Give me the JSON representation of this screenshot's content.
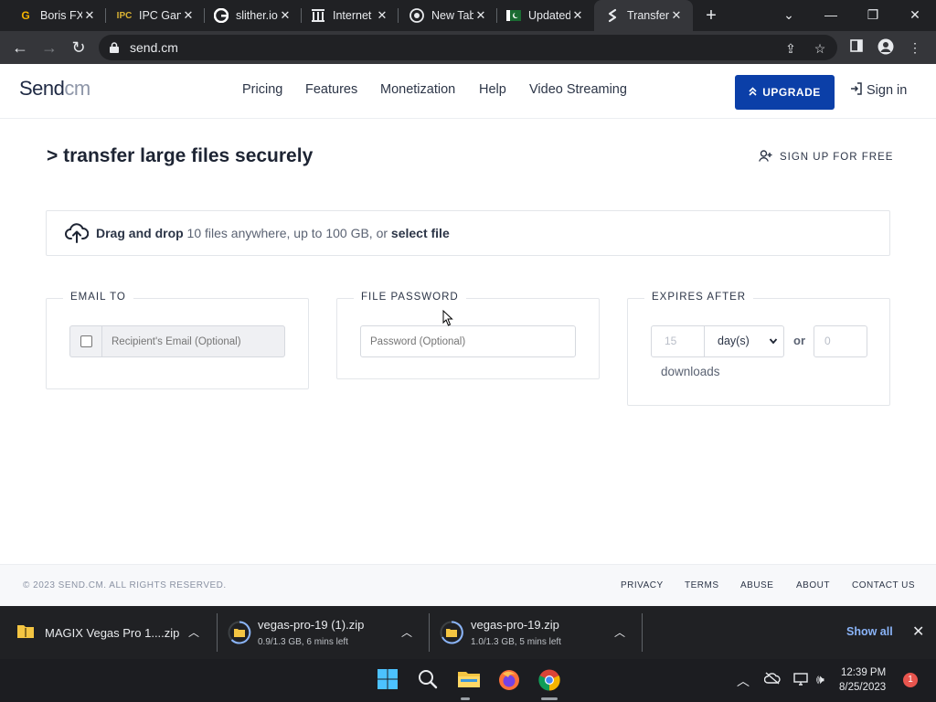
{
  "browser": {
    "tabs": [
      {
        "title": "Boris FX",
        "favicon": "G",
        "favicon_color": "#f4b400",
        "icon": "google-g-icon"
      },
      {
        "title": "IPC Gan",
        "favicon": "IPC",
        "favicon_color": "#d9b234",
        "icon": "ipc-icon"
      },
      {
        "title": "slither.io",
        "favicon": "G",
        "favicon_color": "#ffffff",
        "icon": "google-icon"
      },
      {
        "title": "Internet",
        "favicon": "🏛",
        "favicon_color": "#e8eaed",
        "icon": "archive-icon"
      },
      {
        "title": "New Tab",
        "favicon": "◎",
        "favicon_color": "#e8eaed",
        "icon": "chrome-icon"
      },
      {
        "title": "Updated",
        "favicon": "☪",
        "favicon_color": "#1a7f37",
        "icon": "pakistan-flag-icon"
      },
      {
        "title": "Transfer",
        "favicon": "S",
        "favicon_color": "#e8eaed",
        "icon": "send-cm-icon"
      }
    ],
    "url": "send.cm"
  },
  "site": {
    "logo_primary": "Send",
    "logo_secondary": "cm",
    "nav": [
      "Pricing",
      "Features",
      "Monetization",
      "Help",
      "Video Streaming"
    ],
    "upgrade_label": "UPGRADE",
    "signin_label": "Sign in"
  },
  "main": {
    "headline": "> transfer large files securely",
    "signup_label": "SIGN UP FOR FREE",
    "dropzone": {
      "bold_start": "Drag and drop",
      "middle": " 10 files anywhere, up to 100 GB, or ",
      "bold_end": "select file"
    },
    "email": {
      "legend": "EMAIL TO",
      "placeholder": "Recipient's Email (Optional)"
    },
    "password": {
      "legend": "FILE PASSWORD",
      "placeholder": "Password (Optional)"
    },
    "expires": {
      "legend": "EXPIRES AFTER",
      "count_placeholder": "15",
      "unit": "day(s)",
      "or_label": "or",
      "downloads_placeholder": "0",
      "downloads_label": "downloads"
    }
  },
  "footer": {
    "copyright": "© 2023 SEND.CM. ALL RIGHTS RESERVED.",
    "links": [
      "PRIVACY",
      "TERMS",
      "ABUSE",
      "ABOUT",
      "CONTACT US"
    ]
  },
  "downloads": {
    "items": [
      {
        "name": "MAGIX Vegas Pro 1....zip",
        "status": ""
      },
      {
        "name": "vegas-pro-19 (1).zip",
        "status": "0.9/1.3 GB, 6 mins left"
      },
      {
        "name": "vegas-pro-19.zip",
        "status": "1.0/1.3 GB, 5 mins left"
      }
    ],
    "show_all": "Show all"
  },
  "taskbar": {
    "time": "12:39 PM",
    "date": "8/25/2023",
    "notification_count": "1"
  },
  "colors": {
    "brand_blue": "#0b3fa8",
    "chrome_dark": "#202124",
    "link_blue": "#8ab4f8"
  }
}
